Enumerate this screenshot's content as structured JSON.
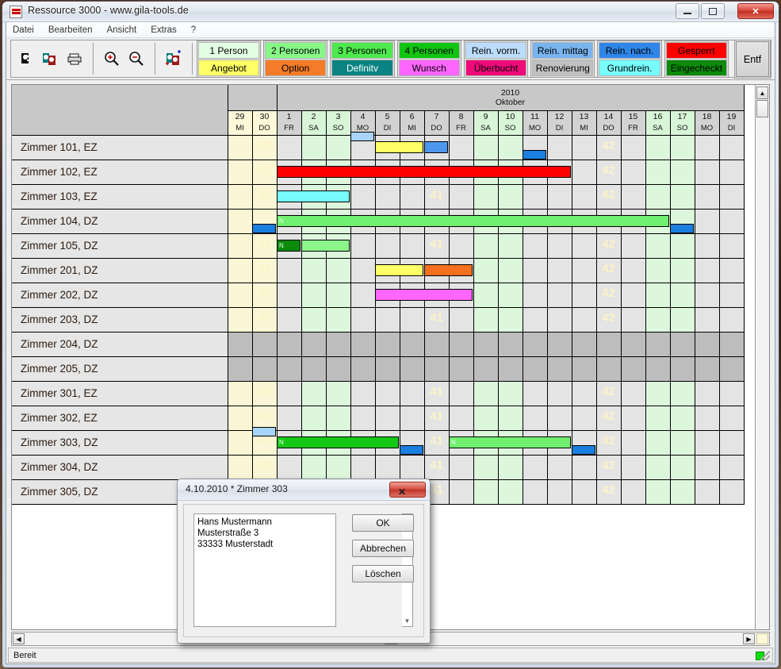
{
  "window": {
    "title": "Ressource 3000 - www.gila-tools.de",
    "minimize": "–",
    "maximize": "□",
    "close": "✕"
  },
  "menu": [
    "Datei",
    "Bearbeiten",
    "Ansicht",
    "Extras",
    "?"
  ],
  "toolbar": {
    "icons": [
      "guest-icon",
      "guests-exchange-icon",
      "print-icon",
      "zoom-in-icon",
      "zoom-out-icon",
      "guests-add-icon"
    ],
    "legend": [
      {
        "top": "1 Person",
        "top_bg": "#e3ffe3",
        "top_fg": "#000000",
        "bottom": "Angebot",
        "bottom_bg": "#ffff66",
        "bottom_fg": "#000000"
      },
      {
        "top": "2 Personen",
        "top_bg": "#88f788",
        "top_fg": "#000000",
        "bottom": "Option",
        "bottom_bg": "#f47b28",
        "bottom_fg": "#000000"
      },
      {
        "top": "3 Personen",
        "top_bg": "#4ee94e",
        "top_fg": "#000000",
        "bottom": "Definitv",
        "bottom_bg": "#0b8383",
        "bottom_fg": "#ffffff"
      },
      {
        "top": "4 Personen",
        "top_bg": "#10c410",
        "top_fg": "#000000",
        "bottom": "Wunsch",
        "bottom_bg": "#ff66ff",
        "bottom_fg": "#000000"
      },
      {
        "top": "Rein. vorm.",
        "top_bg": "#bcdcfb",
        "top_fg": "#000000",
        "bottom": "Überbucht",
        "bottom_bg": "#ef0a7a",
        "bottom_fg": "#000000"
      },
      {
        "top": "Rein. mittag",
        "top_bg": "#79b4ef",
        "top_fg": "#000000",
        "bottom": "Renovierung",
        "bottom_bg": "#c0c0c0",
        "bottom_fg": "#000000"
      },
      {
        "top": "Rein. nach.",
        "top_bg": "#2f86e8",
        "top_fg": "#000000",
        "bottom": "Grundrein.",
        "bottom_bg": "#77fbfb",
        "bottom_fg": "#000000"
      },
      {
        "top": "Gesperrt",
        "top_bg": "#ff0000",
        "top_fg": "#000000",
        "bottom": "Eingecheckt",
        "bottom_bg": "#0b8a0b",
        "bottom_fg": "#000000"
      }
    ],
    "delete_label": "Entf"
  },
  "calendar": {
    "year": "2010",
    "month": "Oktober",
    "days": [
      {
        "n": "29",
        "w": "MI",
        "type": "prev"
      },
      {
        "n": "30",
        "w": "DO",
        "type": "prev"
      },
      {
        "n": "1",
        "w": "FR",
        "type": "work"
      },
      {
        "n": "2",
        "w": "SA",
        "type": "weekend"
      },
      {
        "n": "3",
        "w": "SO",
        "type": "weekend"
      },
      {
        "n": "4",
        "w": "MO",
        "type": "work"
      },
      {
        "n": "5",
        "w": "DI",
        "type": "work"
      },
      {
        "n": "6",
        "w": "MI",
        "type": "work"
      },
      {
        "n": "7",
        "w": "DO",
        "type": "work"
      },
      {
        "n": "8",
        "w": "FR",
        "type": "work"
      },
      {
        "n": "9",
        "w": "SA",
        "type": "weekend"
      },
      {
        "n": "10",
        "w": "SO",
        "type": "weekend"
      },
      {
        "n": "11",
        "w": "MO",
        "type": "work"
      },
      {
        "n": "12",
        "w": "DI",
        "type": "work"
      },
      {
        "n": "13",
        "w": "MI",
        "type": "work"
      },
      {
        "n": "14",
        "w": "DO",
        "type": "work"
      },
      {
        "n": "15",
        "w": "FR",
        "type": "work"
      },
      {
        "n": "16",
        "w": "SA",
        "type": "weekend"
      },
      {
        "n": "17",
        "w": "SO",
        "type": "weekend"
      },
      {
        "n": "18",
        "w": "MO",
        "type": "work"
      },
      {
        "n": "19",
        "w": "DI",
        "type": "work"
      }
    ],
    "week_markers": [
      {
        "col": 1,
        "label": "40"
      },
      {
        "col": 8,
        "label": "41"
      },
      {
        "col": 15,
        "label": "42"
      }
    ]
  },
  "rooms": [
    {
      "label": "Zimmer 101, EZ",
      "blocked": false,
      "week": "42",
      "bars": [
        {
          "start": 5,
          "span": 1,
          "color": "#a8d4fb",
          "pos": "arrive",
          "half": "none",
          "text": ""
        },
        {
          "start": 6,
          "span": 2,
          "color": "#ffff66",
          "pos": "main",
          "half": "none",
          "text": ""
        },
        {
          "start": 8,
          "span": 1,
          "color": "#4d98ee",
          "pos": "main",
          "half": "none",
          "text": ""
        },
        {
          "start": 12,
          "span": 1,
          "color": "#1a7fe0",
          "pos": "depart",
          "half": "none",
          "text": ""
        }
      ]
    },
    {
      "label": "Zimmer 102, EZ",
      "blocked": false,
      "week": "42",
      "bars": [
        {
          "start": 2,
          "span": 12,
          "color": "#ff0000",
          "pos": "main",
          "half": "none",
          "text": ""
        }
      ]
    },
    {
      "label": "Zimmer 103, EZ",
      "blocked": false,
      "week": "42",
      "bars": [
        {
          "start": 2,
          "span": 3,
          "color": "#77fbfb",
          "pos": "main",
          "half": "none",
          "text": ""
        }
      ]
    },
    {
      "label": "Zimmer 104, DZ",
      "blocked": false,
      "week": "",
      "bars": [
        {
          "start": 1,
          "span": 1,
          "color": "#1a7fe0",
          "pos": "depart",
          "half": "none",
          "text": ""
        },
        {
          "start": 2,
          "span": 16,
          "color": "#70f070",
          "pos": "main",
          "half": "none",
          "text": "N"
        },
        {
          "start": 18,
          "span": 1,
          "color": "#1a7fe0",
          "pos": "depart",
          "half": "none",
          "text": ""
        }
      ]
    },
    {
      "label": "Zimmer 105, DZ",
      "blocked": false,
      "week": "42",
      "bars": [
        {
          "start": 2,
          "span": 1,
          "color": "#0b8a0b",
          "pos": "main",
          "half": "none",
          "text": "N"
        },
        {
          "start": 3,
          "span": 2,
          "color": "#8cf58c",
          "pos": "main",
          "half": "none",
          "text": ""
        }
      ]
    },
    {
      "label": "Zimmer 201, DZ",
      "blocked": false,
      "week": "42",
      "bars": [
        {
          "start": 6,
          "span": 2,
          "color": "#ffff66",
          "pos": "main",
          "half": "none",
          "text": ""
        },
        {
          "start": 8,
          "span": 2,
          "color": "#f4701e",
          "pos": "main",
          "half": "none",
          "text": ""
        }
      ]
    },
    {
      "label": "Zimmer 202, DZ",
      "blocked": false,
      "week": "42",
      "bars": [
        {
          "start": 6,
          "span": 4,
          "color": "#ff66ff",
          "pos": "main",
          "half": "none",
          "text": ""
        }
      ]
    },
    {
      "label": "Zimmer 203, DZ",
      "blocked": false,
      "week": "42",
      "bars": []
    },
    {
      "label": "Zimmer 204, DZ",
      "blocked": true,
      "week": "",
      "bars": []
    },
    {
      "label": "Zimmer 205, DZ",
      "blocked": true,
      "week": "",
      "bars": []
    },
    {
      "label": "Zimmer 301, EZ",
      "blocked": false,
      "week": "42",
      "bars": []
    },
    {
      "label": "Zimmer 302, EZ",
      "blocked": false,
      "week": "42",
      "bars": []
    },
    {
      "label": "Zimmer 303, DZ",
      "blocked": false,
      "week": "42",
      "bars": [
        {
          "start": 1,
          "span": 1,
          "color": "#a8d4fb",
          "pos": "arrive",
          "half": "none",
          "text": ""
        },
        {
          "start": 2,
          "span": 5,
          "color": "#16c816",
          "pos": "main",
          "half": "none",
          "text": "N"
        },
        {
          "start": 7,
          "span": 1,
          "color": "#1a7fe0",
          "pos": "depart",
          "half": "none",
          "text": ""
        },
        {
          "start": 9,
          "span": 5,
          "color": "#70f070",
          "pos": "main",
          "half": "none",
          "text": "N"
        },
        {
          "start": 14,
          "span": 1,
          "color": "#1a7fe0",
          "pos": "depart",
          "half": "none",
          "text": ""
        }
      ]
    },
    {
      "label": "Zimmer 304, DZ",
      "blocked": false,
      "week": "42",
      "bars": []
    },
    {
      "label": "Zimmer 305, DZ",
      "blocked": false,
      "week": "42",
      "bars": []
    }
  ],
  "dialog": {
    "title": "4.10.2010 * Zimmer 303",
    "close": "✕",
    "list_text": "Hans Mustermann\nMusterstraße 3\n33333 Musterstadt",
    "scroll_up": "▲",
    "scroll_down": "▼",
    "ok": "OK",
    "cancel": "Abbrechen",
    "delete": "Löschen"
  },
  "status": {
    "text": "Bereit"
  },
  "scroll": {
    "up": "▲",
    "left": "◀",
    "right": "▶"
  }
}
